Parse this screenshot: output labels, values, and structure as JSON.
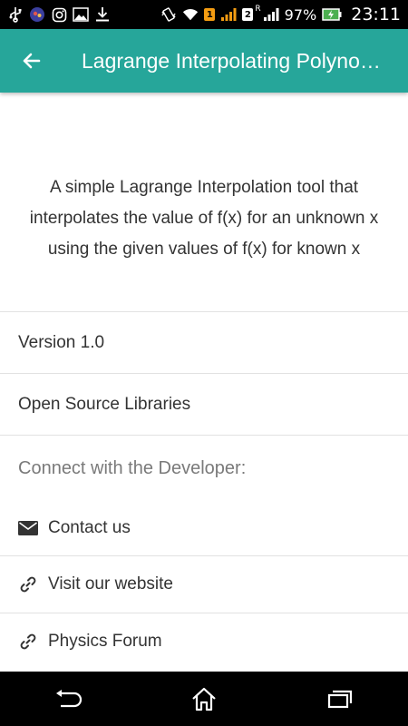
{
  "status_bar": {
    "icons": [
      "usb-icon",
      "app-icon",
      "instagram-icon",
      "gallery-icon",
      "download-icon",
      "vibrate-icon",
      "wifi-icon",
      "sim1-signal-icon",
      "sim2-signal-icon",
      "battery-icon"
    ],
    "sim1_label": "1",
    "sim2_label": "2",
    "roaming_label": "R",
    "battery_pct": "97%",
    "time": "23:11"
  },
  "app_bar": {
    "title": "Lagrange Interpolating Polynomial Calculator",
    "back_icon": "arrow-left-icon",
    "color": "#26A69A"
  },
  "about": {
    "description": "A simple Lagrange Interpolation tool that interpolates the value of f(x) for an unknown x using the given values of f(x) for known x",
    "version": "Version 1.0",
    "open_source": "Open Source Libraries",
    "connect_header": "Connect with the Developer:",
    "links": [
      {
        "label": "Contact us",
        "icon": "mail-icon"
      },
      {
        "label": "Visit our website",
        "icon": "link-icon"
      },
      {
        "label": "Physics Forum",
        "icon": "link-icon"
      }
    ]
  },
  "nav_bar": {
    "icons": [
      "back-nav-icon",
      "home-nav-icon",
      "recents-nav-icon"
    ]
  }
}
